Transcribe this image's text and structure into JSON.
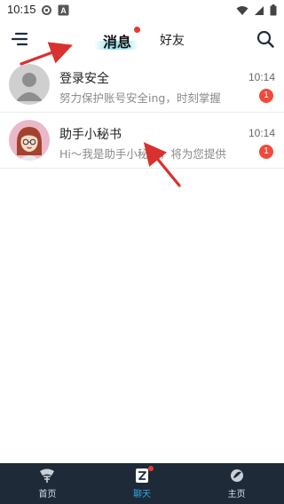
{
  "status_bar": {
    "time": "10:15",
    "icons_left": [
      "settings-icon",
      "notification-a-icon"
    ],
    "icons_right": [
      "wifi-icon",
      "signal-icon",
      "battery-icon"
    ]
  },
  "header": {
    "menu_icon": "menu-icon",
    "tabs": [
      {
        "label": "消息",
        "active": true,
        "has_dot": true
      },
      {
        "label": "好友",
        "active": false
      }
    ],
    "search_icon": "search-icon"
  },
  "chats": [
    {
      "name": "登录安全",
      "preview": "努力保护账号安全ing，时刻掌握",
      "time": "10:14",
      "unread": "1",
      "avatar": "default-user-avatar"
    },
    {
      "name": "助手小秘书",
      "preview": "Hi～我是助手小秘书，将为您提供",
      "time": "10:14",
      "unread": "1",
      "avatar": "assistant-girl-avatar"
    }
  ],
  "bottom_nav": {
    "items": [
      {
        "label": "首页",
        "icon": "home-icon",
        "active": false
      },
      {
        "label": "聊天",
        "icon": "chat-icon",
        "active": true,
        "has_dot": true
      },
      {
        "label": "主页",
        "icon": "profile-icon",
        "active": false
      }
    ]
  },
  "colors": {
    "accent": "#2fa4e7",
    "badge": "#f24a3a",
    "nav_bg": "#1e2a38",
    "annotation_arrow": "#d93030"
  }
}
